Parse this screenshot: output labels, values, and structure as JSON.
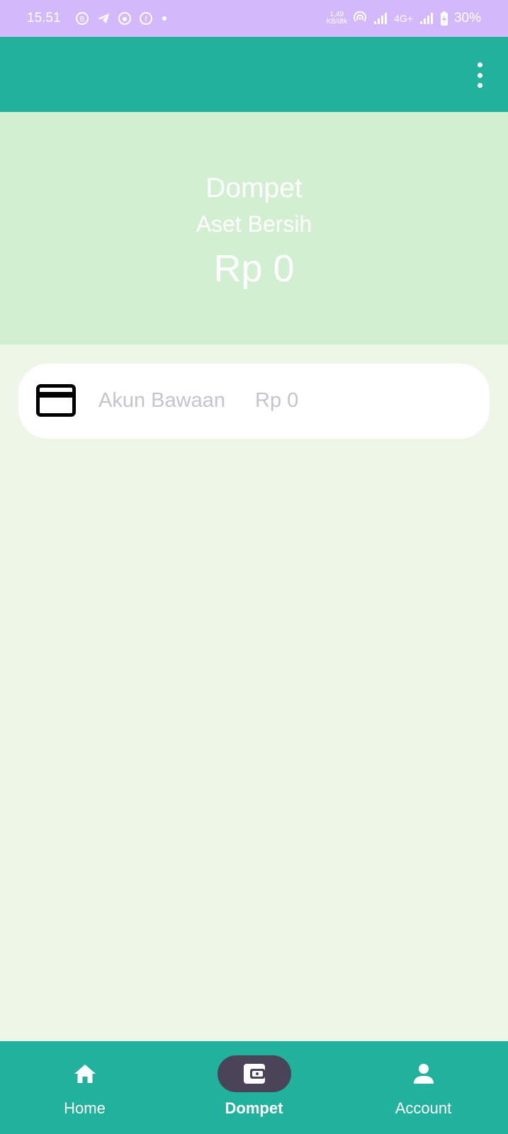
{
  "status_bar": {
    "time": "15.51",
    "speed_value": "1,49",
    "speed_unit": "KB/dtk",
    "network": "4G+",
    "battery": "30%"
  },
  "summary": {
    "title": "Dompet",
    "subtitle": "Aset Bersih",
    "amount": "Rp 0"
  },
  "accounts": [
    {
      "name": "Akun Bawaan",
      "balance": "Rp 0",
      "icon": "credit-card-icon"
    }
  ],
  "bottom_nav": {
    "items": [
      {
        "label": "Home",
        "icon": "home-icon",
        "active": false
      },
      {
        "label": "Dompet",
        "icon": "wallet-icon",
        "active": true
      },
      {
        "label": "Account",
        "icon": "person-icon",
        "active": false
      }
    ]
  },
  "colors": {
    "status_bar": "#d3b9fb",
    "primary": "#22b19d",
    "summary_bg": "#d2efd2",
    "page_bg": "#eef7e7",
    "active_indicator": "#4a4459"
  }
}
